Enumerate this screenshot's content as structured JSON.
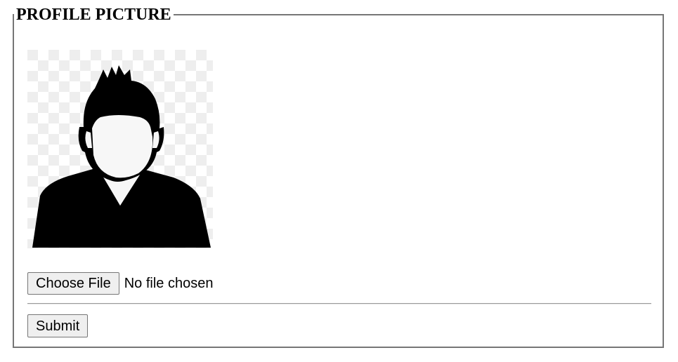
{
  "form": {
    "legend": "PROFILE PICTURE",
    "avatar": {
      "icon": "default-user-avatar-icon",
      "background": "transparency-checkerboard"
    },
    "file_input": {
      "button_label": "Choose File",
      "status_text": "No file chosen"
    },
    "submit_label": "Submit"
  },
  "colors": {
    "border": "#767676",
    "button_bg": "#efefef",
    "avatar_fill": "#000000",
    "checker_light": "#ffffff",
    "checker_dark": "#eeeeee"
  }
}
